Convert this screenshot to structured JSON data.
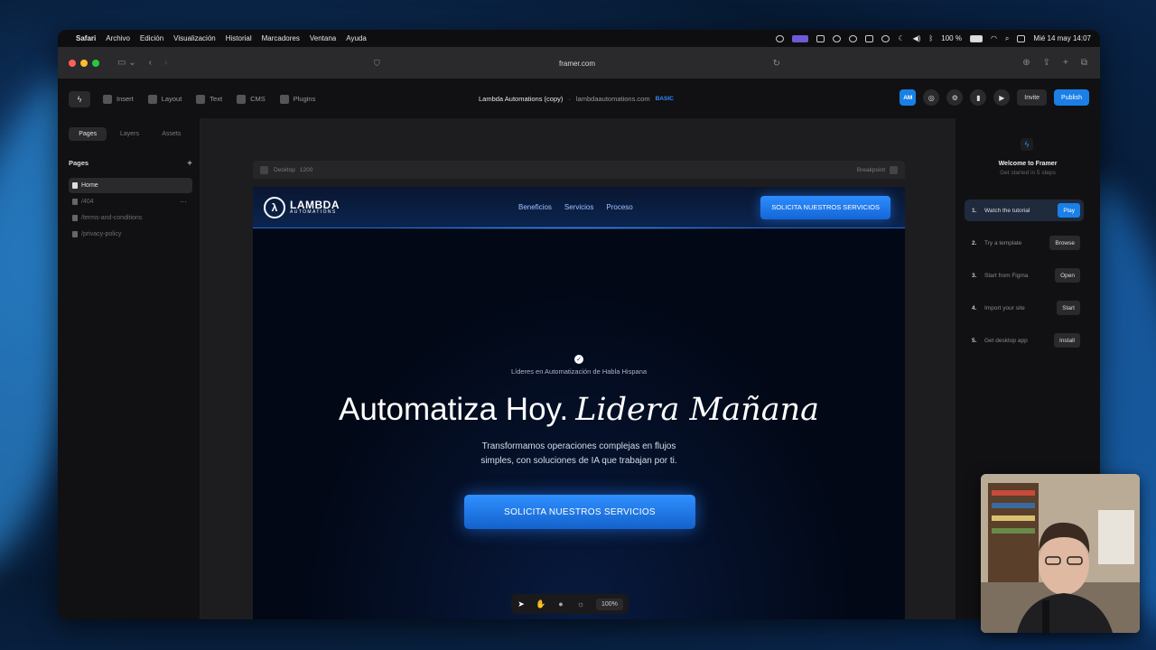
{
  "menubar": {
    "app": "Safari",
    "items": [
      "Archivo",
      "Edición",
      "Visualización",
      "Historial",
      "Marcadores",
      "Ventana",
      "Ayuda"
    ],
    "battery": "100 %",
    "datetime": "Mié 14 may 14:07"
  },
  "safari": {
    "url": "framer.com"
  },
  "framer": {
    "toolbar": {
      "insert": "Insert",
      "layout": "Layout",
      "text": "Text",
      "cms": "CMS",
      "plugins": "Plugins"
    },
    "project_name": "Lambda Automations (copy)",
    "domain": "lambdaautomations.com",
    "plan": "BASIC",
    "avatar": "AM",
    "invite": "Invite",
    "publish": "Publish"
  },
  "left_panel": {
    "tabs": [
      "Pages",
      "Layers",
      "Assets"
    ],
    "heading": "Pages",
    "pages": [
      "Home",
      "/404",
      "/terms-and-conditions",
      "/privacy-policy"
    ]
  },
  "canvas": {
    "breakpoint_label": "Desktop",
    "breakpoint_width": "1200",
    "breakpoint_button": "Breakpoint",
    "zoom": "100%"
  },
  "site": {
    "logo_line1": "LAMBDA",
    "logo_line2": "AUTOMATIONS",
    "nav_links": [
      "Beneficios",
      "Servicios",
      "Proceso"
    ],
    "nav_cta": "SOLICITA NUESTROS SERVICIOS",
    "kicker": "Líderes en Automatización de Habla Hispana",
    "title_plain": "Automatiza Hoy.",
    "title_accent": "Lidera Mañana",
    "subtitle_line1": "Transformamos operaciones complejas en flujos",
    "subtitle_line2": "simples, con soluciones de IA que trabajan por ti.",
    "hero_cta": "SOLICITA NUESTROS SERVICIOS"
  },
  "right_panel": {
    "title": "Welcome to Framer",
    "subtitle": "Get started in 5 steps",
    "steps": [
      {
        "num": "1.",
        "label": "Watch the tutorial",
        "button": "Play"
      },
      {
        "num": "2.",
        "label": "Try a template",
        "button": "Browse"
      },
      {
        "num": "3.",
        "label": "Start from Figma",
        "button": "Open"
      },
      {
        "num": "4.",
        "label": "Import your site",
        "button": "Start"
      },
      {
        "num": "5.",
        "label": "Get desktop app",
        "button": "Install"
      }
    ]
  },
  "colors": {
    "accent": "#1a7fe6",
    "site_bg": "#020816",
    "canvas_bg": "#1d1d20"
  }
}
